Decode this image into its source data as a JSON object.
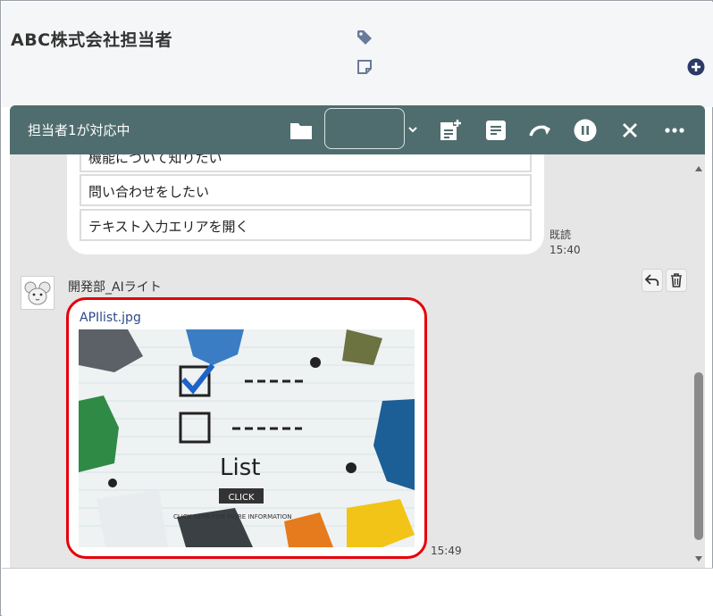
{
  "header": {
    "contact_name": "ABC株式会社担当者"
  },
  "toolbar": {
    "status_label": "担当者1が対応中",
    "assignee_value": ""
  },
  "chat": {
    "bot_options": [
      "機能について知りたい",
      "問い合わせをしたい",
      "テキスト入力エリアを開く"
    ],
    "read_label": "既読",
    "read_time": "15:40",
    "sender_name": "開発部_AIライト",
    "file_name": "APIlist.jpg",
    "file_time": "15:49",
    "preview": {
      "title": "List",
      "click_label": "CLICK",
      "caption": "CLICK HERE FOR MORE INFORMATION"
    }
  },
  "colors": {
    "toolbar_bg": "#4f6d6e",
    "highlight_border": "#e5000a",
    "link": "#2b4a8b",
    "add_icon": "#2b3a67"
  },
  "icons": [
    "tag-icon",
    "note-icon",
    "add-circle-icon",
    "folder-icon",
    "chevron-down-icon",
    "note-add-icon",
    "document-icon",
    "redirect-icon",
    "pause-icon",
    "close-icon",
    "more-icon",
    "reply-icon",
    "trash-icon",
    "scroll-up-icon",
    "scroll-down-icon"
  ]
}
